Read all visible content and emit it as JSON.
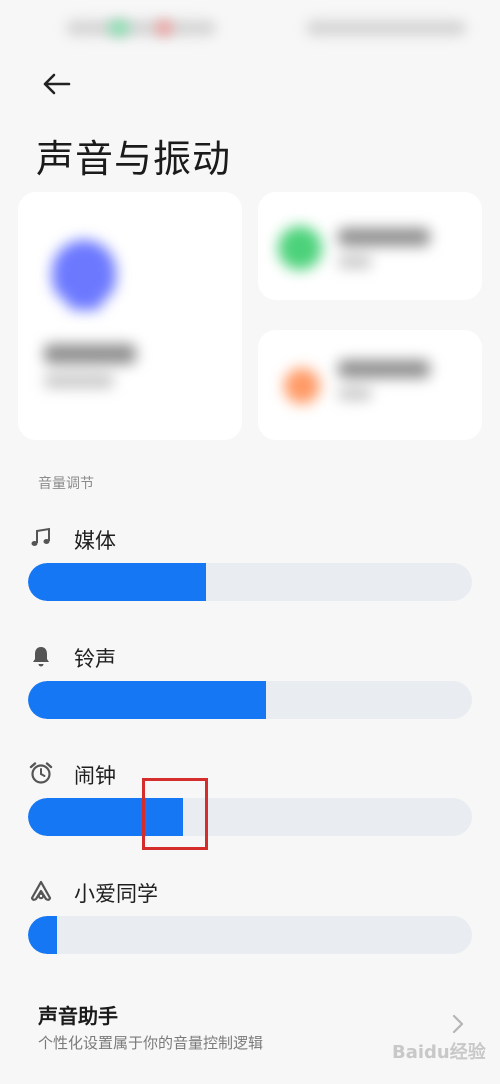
{
  "header": {
    "title": "声音与振动",
    "back_icon": "arrow-left-icon"
  },
  "section_label": "音量调节",
  "volume_rows": [
    {
      "label": "媒体",
      "icon": "music-note-icon",
      "level": 0.4
    },
    {
      "label": "铃声",
      "icon": "bell-icon",
      "level": 0.535
    },
    {
      "label": "闹钟",
      "icon": "alarm-clock-icon",
      "level": 0.35
    },
    {
      "label": "小爱同学",
      "icon": "xiaoai-icon",
      "level": 0.065
    }
  ],
  "assistant": {
    "title": "声音助手",
    "subtitle": "个性化设置属于你的音量控制逻辑"
  },
  "watermark": "Baidu经验",
  "colors": {
    "accent": "#1677f5",
    "track": "#e9ecf1",
    "highlight": "#d52c2c"
  }
}
